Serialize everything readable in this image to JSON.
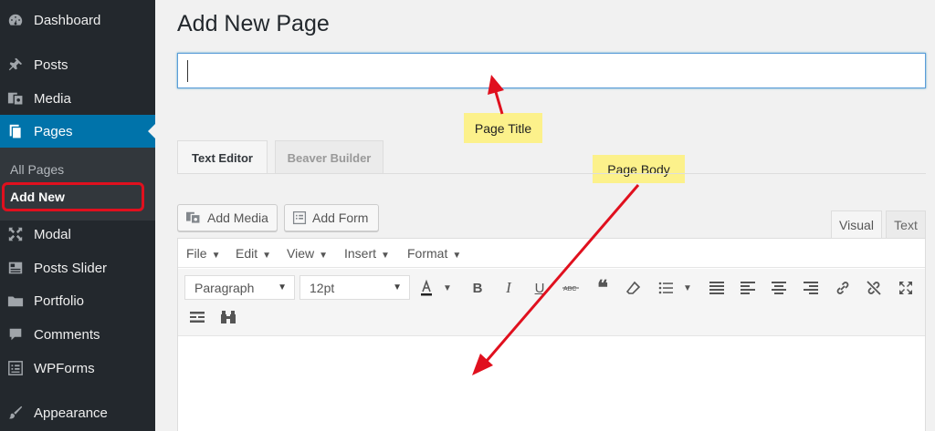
{
  "sidebar": {
    "items": [
      {
        "label": "Dashboard",
        "icon": "dashboard-icon"
      },
      {
        "label": "Posts",
        "icon": "pin-icon"
      },
      {
        "label": "Media",
        "icon": "media-icon"
      },
      {
        "label": "Pages",
        "icon": "pages-icon"
      },
      {
        "label": "Modal",
        "icon": "move-icon"
      },
      {
        "label": "Posts Slider",
        "icon": "slider-icon"
      },
      {
        "label": "Portfolio",
        "icon": "folder-icon"
      },
      {
        "label": "Comments",
        "icon": "comment-icon"
      },
      {
        "label": "WPForms",
        "icon": "form-icon"
      },
      {
        "label": "Appearance",
        "icon": "brush-icon"
      }
    ],
    "submenu": [
      {
        "label": "All Pages"
      },
      {
        "label": "Add New"
      }
    ]
  },
  "main": {
    "heading": "Add New Page",
    "title_value": ""
  },
  "callouts": {
    "title": "Page Title",
    "body": "Page Body"
  },
  "editor_tabs": [
    "Text Editor",
    "Beaver Builder"
  ],
  "media_buttons": {
    "add_media": "Add Media",
    "add_form": "Add Form"
  },
  "mode_tabs": {
    "visual": "Visual",
    "text": "Text"
  },
  "menubar": [
    "File",
    "Edit",
    "View",
    "Insert",
    "Format"
  ],
  "toolbar": {
    "paragraph": "Paragraph",
    "font_size": "12pt"
  },
  "colors": {
    "sidebar_bg": "#23282d",
    "active_blue": "#0073aa",
    "callout_yellow": "#fcf18b",
    "arrow_red": "#e0101e"
  }
}
